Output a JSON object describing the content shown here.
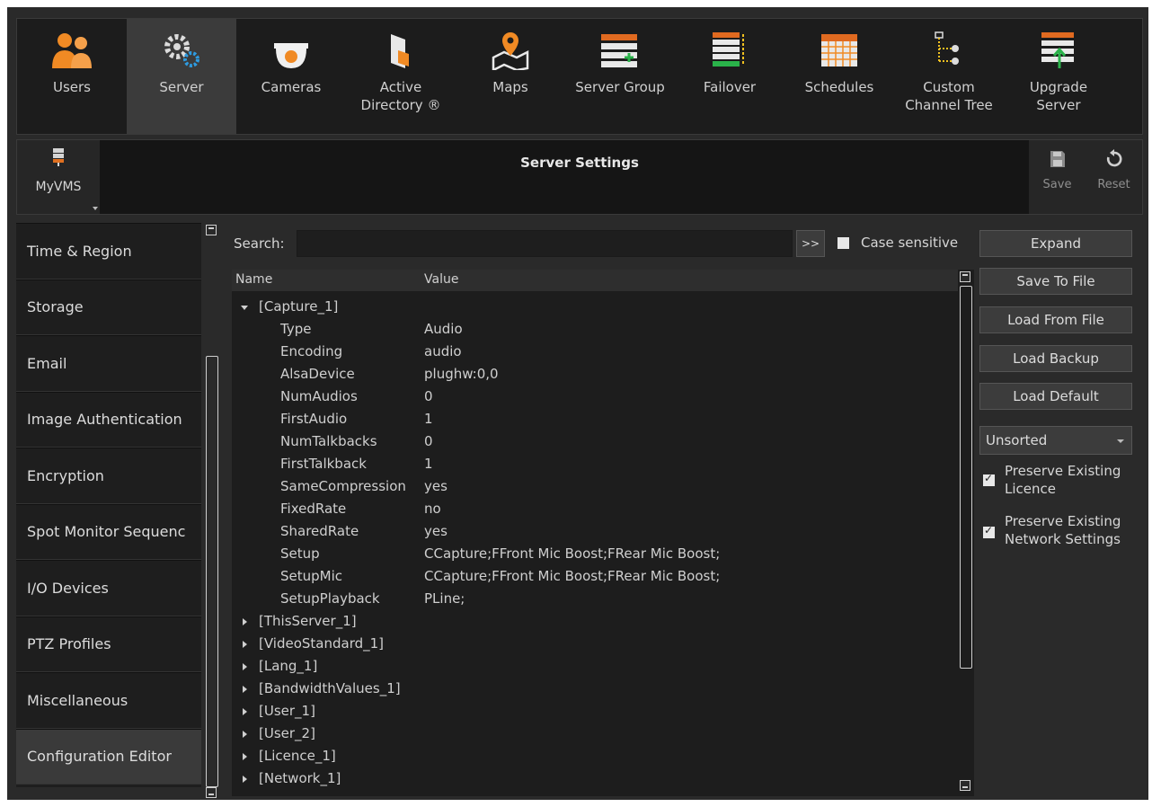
{
  "toolbar": {
    "items": [
      {
        "label": "Users",
        "icon": "users-icon"
      },
      {
        "label": "Server",
        "icon": "server-gear-icon"
      },
      {
        "label": "Cameras",
        "icon": "camera-dome-icon"
      },
      {
        "label": "Active\nDirectory ®",
        "icon": "active-directory-icon"
      },
      {
        "label": "Maps",
        "icon": "map-pin-icon"
      },
      {
        "label": "Server Group",
        "icon": "server-group-icon"
      },
      {
        "label": "Failover",
        "icon": "failover-icon"
      },
      {
        "label": "Schedules",
        "icon": "schedule-grid-icon"
      },
      {
        "label": "Custom\nChannel Tree",
        "icon": "channel-tree-icon"
      },
      {
        "label": "Upgrade\nServer",
        "icon": "upgrade-server-icon"
      }
    ],
    "active": "Server"
  },
  "header": {
    "server_name": "MyVMS",
    "title": "Server Settings",
    "save_label": "Save",
    "reset_label": "Reset"
  },
  "nav": {
    "items": [
      "Time & Region",
      "Storage",
      "Email",
      "Image Authentication",
      "Encryption",
      "Spot Monitor Sequenc",
      "I/O Devices",
      "PTZ Profiles",
      "Miscellaneous",
      "Configuration Editor"
    ],
    "active": "Configuration Editor"
  },
  "search": {
    "label": "Search:",
    "value": "",
    "go_label": ">>",
    "case_label": "Case sensitive"
  },
  "tree": {
    "col_name": "Name",
    "col_value": "Value",
    "sections": [
      {
        "name": "[Capture_1]",
        "expanded": true,
        "entries": [
          {
            "k": "Type",
            "v": "Audio"
          },
          {
            "k": "Encoding",
            "v": "audio"
          },
          {
            "k": "AlsaDevice",
            "v": "plughw:0,0"
          },
          {
            "k": "NumAudios",
            "v": "0"
          },
          {
            "k": "FirstAudio",
            "v": "1"
          },
          {
            "k": "NumTalkbacks",
            "v": "0"
          },
          {
            "k": "FirstTalkback",
            "v": "1"
          },
          {
            "k": "SameCompression",
            "v": "yes"
          },
          {
            "k": "FixedRate",
            "v": "no"
          },
          {
            "k": "SharedRate",
            "v": "yes"
          },
          {
            "k": "Setup",
            "v": "CCapture;FFront Mic Boost;FRear Mic Boost;"
          },
          {
            "k": "SetupMic",
            "v": "CCapture;FFront Mic Boost;FRear Mic Boost;"
          },
          {
            "k": "SetupPlayback",
            "v": "PLine;"
          }
        ]
      },
      {
        "name": "[ThisServer_1]",
        "expanded": false
      },
      {
        "name": "[VideoStandard_1]",
        "expanded": false
      },
      {
        "name": "[Lang_1]",
        "expanded": false
      },
      {
        "name": "[BandwidthValues_1]",
        "expanded": false
      },
      {
        "name": "[User_1]",
        "expanded": false
      },
      {
        "name": "[User_2]",
        "expanded": false
      },
      {
        "name": "[Licence_1]",
        "expanded": false
      },
      {
        "name": "[Network_1]",
        "expanded": false
      }
    ]
  },
  "right": {
    "expand_label": "Expand",
    "save_to_file_label": "Save To File",
    "load_from_file_label": "Load From File",
    "load_backup_label": "Load Backup",
    "load_default_label": "Load Default",
    "sort_value": "Unsorted",
    "preserve_licence_label": "Preserve Existing Licence",
    "preserve_network_label": "Preserve Existing Network Settings"
  }
}
